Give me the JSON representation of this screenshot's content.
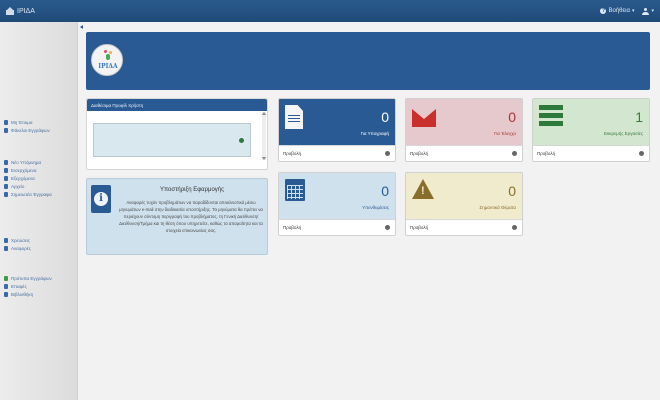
{
  "app": {
    "title": "ΙΡΙΔΑ"
  },
  "topbar": {
    "help_label": "Βοήθεια",
    "user_caret": "▾"
  },
  "sidebar": {
    "group1": [
      {
        "label": "Μη Έτοιμα",
        "icon": "envelope-icon"
      },
      {
        "label": "Φάκελοι Εγγράφων",
        "icon": "user-icon"
      }
    ],
    "group2": [
      {
        "label": "Νέο Υπόμνημα",
        "icon": "pencil-icon"
      },
      {
        "label": "Εισερχόμενα",
        "icon": "inbox-icon"
      },
      {
        "label": "Εξερχόμενα",
        "icon": "outbox-icon"
      },
      {
        "label": "Αρχείο",
        "icon": "archive-icon"
      },
      {
        "label": "Σημειωτέα Έγγραφα",
        "icon": "bookmark-icon"
      }
    ],
    "group3": [
      {
        "label": "Χρεώσεις",
        "icon": "list-icon"
      },
      {
        "label": "Αναφορές",
        "icon": "chart-icon"
      }
    ],
    "group4": [
      {
        "label": "Πρότυπα Εγγράφων",
        "icon": "template-icon"
      },
      {
        "label": "Επαφές",
        "icon": "contacts-icon"
      },
      {
        "label": "Βιβλιοθήκη",
        "icon": "book-icon"
      }
    ]
  },
  "banner": {
    "logo_text": "ΙΡΙΔΑ"
  },
  "news": {
    "title": "Διαθέσιμα Προφίλ Χρήστη"
  },
  "support": {
    "title": "Υποστήριξη Εφαρμογής",
    "text": "Αναφορές τυχόν προβλημάτων να παραδίδονται αποκλειστικά μέσω μηνυμάτων e-mail στην διαδικασία υποστήριξης. Τα μηνύματα θα πρέπει να περιέχουν σύντομη περιγραφή του προβλήματος, τη Γενική Διεύθυνση/Διεύθυνση/Τμήμα και τη θέση όπου υπηρετείτε, καθώς τα απαραίτητα και τα στοιχεία επικοινωνίας σας."
  },
  "cards": [
    {
      "count": "0",
      "label": "Για Υπογραφή",
      "footer": "Προβολή",
      "icon": "document-icon",
      "color": "#2a5a94"
    },
    {
      "count": "0",
      "label": "Για Έλεγχο",
      "footer": "Προβολή",
      "icon": "envelope-icon",
      "color": "#c9302c"
    },
    {
      "count": "1",
      "label": "Εκκρεμής Εργασίες",
      "footer": "Προβολή",
      "icon": "list-icon",
      "color": "#2f7a3a"
    },
    {
      "count": "0",
      "label": "Υπενθυμίσεις",
      "footer": "Προβολή",
      "icon": "calendar-icon",
      "color": "#2a5a94"
    },
    {
      "count": "0",
      "label": "Σημαντικά Θέματα",
      "footer": "Προβολή",
      "icon": "warning-icon",
      "color": "#8a6d2b"
    }
  ]
}
